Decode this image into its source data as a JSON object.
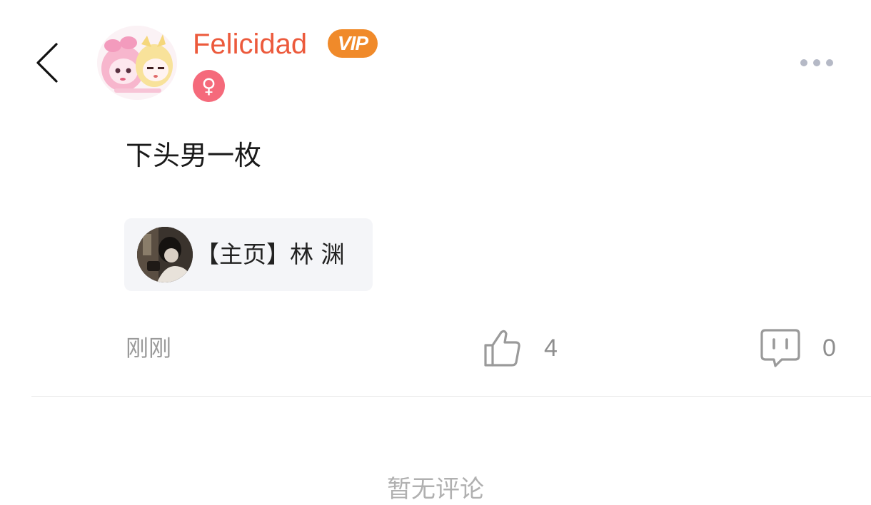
{
  "header": {
    "back_icon": "chevron-left-icon",
    "username": "Felicidad",
    "vip_label": "VIP",
    "gender_symbol": "♀",
    "more_icon": "more-horizontal-icon"
  },
  "post": {
    "text": "下头男一枚",
    "link_card": {
      "label": "【主页】林  渊"
    },
    "timestamp": "刚刚",
    "like_count": "4",
    "comment_count": "0"
  },
  "comments": {
    "empty_text": "暂无评论"
  },
  "colors": {
    "username": "#ec5a3c",
    "vip": "#f08a2a",
    "gender": "#f56a7b",
    "card_bg": "#f4f5f8",
    "meta_text": "#9a9a9a"
  }
}
